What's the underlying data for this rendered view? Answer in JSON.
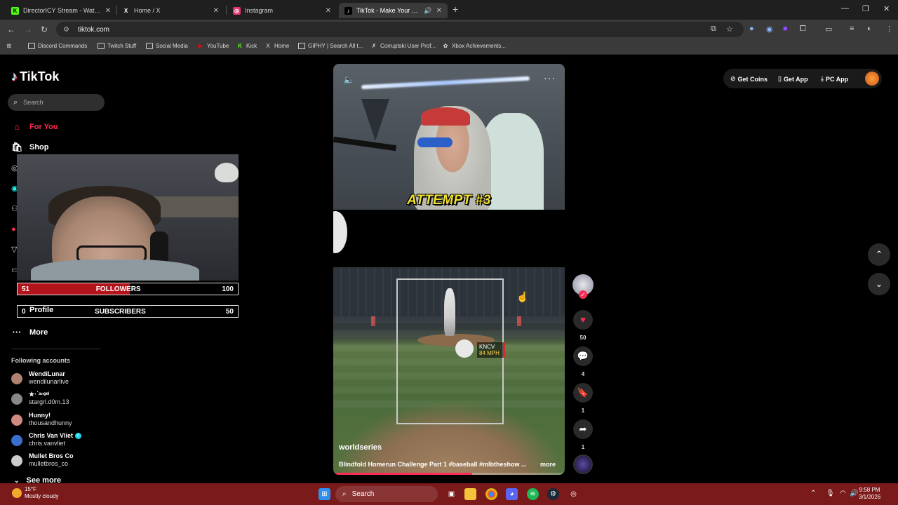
{
  "browser": {
    "tabs": [
      {
        "title": "DirectorICY Stream - Watch Liv",
        "favicon": "K",
        "favicon_color": "#53fc18"
      },
      {
        "title": "Home / X",
        "favicon": "X",
        "favicon_color": "#ffffff"
      },
      {
        "title": "Instagram",
        "favicon": "◎",
        "favicon_color": "#e1306c"
      },
      {
        "title": "TikTok - Make Your Day",
        "favicon": "♪",
        "favicon_color": "#ffffff",
        "active": true
      }
    ],
    "url": "tiktok.com",
    "bookmarks": [
      {
        "label": "Discord Commands",
        "icon": "folder-icon"
      },
      {
        "label": "Twitch Stuff",
        "icon": "folder-icon"
      },
      {
        "label": "Social Media",
        "icon": "folder-icon"
      },
      {
        "label": "YouTube",
        "icon": "youtube-icon"
      },
      {
        "label": "Kick",
        "icon": "kick-icon"
      },
      {
        "label": "Home",
        "icon": "x-icon"
      },
      {
        "label": "GIPHY | Search All t...",
        "icon": "giphy-icon"
      },
      {
        "label": "Corruptski User Prof...",
        "icon": "corruptski-icon"
      },
      {
        "label": "Xbox Achievements...",
        "icon": "xbox-icon"
      }
    ]
  },
  "tiktok": {
    "logo_text": "TikTok",
    "search_placeholder": "Search",
    "nav": {
      "for_you": "For You",
      "shop": "Shop",
      "profile": "Profile",
      "more": "More"
    },
    "accent": "#fe2c55",
    "stream_overlay": {
      "followers": {
        "current": "51",
        "label": "FOLLOWERS",
        "goal": "100",
        "progress": 0.51
      },
      "subscribers": {
        "current": "0",
        "label": "SUBSCRIBERS",
        "goal": "50",
        "progress": 0.0
      }
    },
    "following_title": "Following accounts",
    "accounts": [
      {
        "name": "WendiLunar",
        "username": "wendilunarlive",
        "color": "#b08070",
        "verified": false
      },
      {
        "name": "★·˙ᵃⁿᵍᵉˡ",
        "username": "stargrl.d0m.13",
        "color": "#888888",
        "verified": false
      },
      {
        "name": "Hunny!",
        "username": "thousandhunny",
        "color": "#d08a80",
        "verified": false
      },
      {
        "name": "Chris Van Vliet",
        "username": "chris.vanvliet",
        "color": "#3a6fd0",
        "verified": true
      },
      {
        "name": "Mullet Bros Co",
        "username": "mulletbros_co",
        "color": "#cccccc",
        "verified": false
      }
    ],
    "see_more": "See more",
    "top_actions": {
      "get_coins": "Get Coins",
      "get_app": "Get App",
      "pc_app": "PC App"
    },
    "video": {
      "overlay_text": "ATTEMPT #3",
      "pitch_team": "KNCV",
      "pitch_speed": "84 MPH",
      "author": "worldseries",
      "caption": "Blindfold Homerun Challenge Part 1 #baseball #mlbtheshow ...",
      "more": "more",
      "progress": 0.6
    },
    "actions": {
      "likes": "50",
      "comments": "4",
      "saves": "1",
      "shares": "1"
    }
  },
  "taskbar": {
    "temperature": "15°F",
    "weather": "Mostly cloudy",
    "search": "Search",
    "time": "9:58 PM",
    "date": "3/1/2026"
  }
}
